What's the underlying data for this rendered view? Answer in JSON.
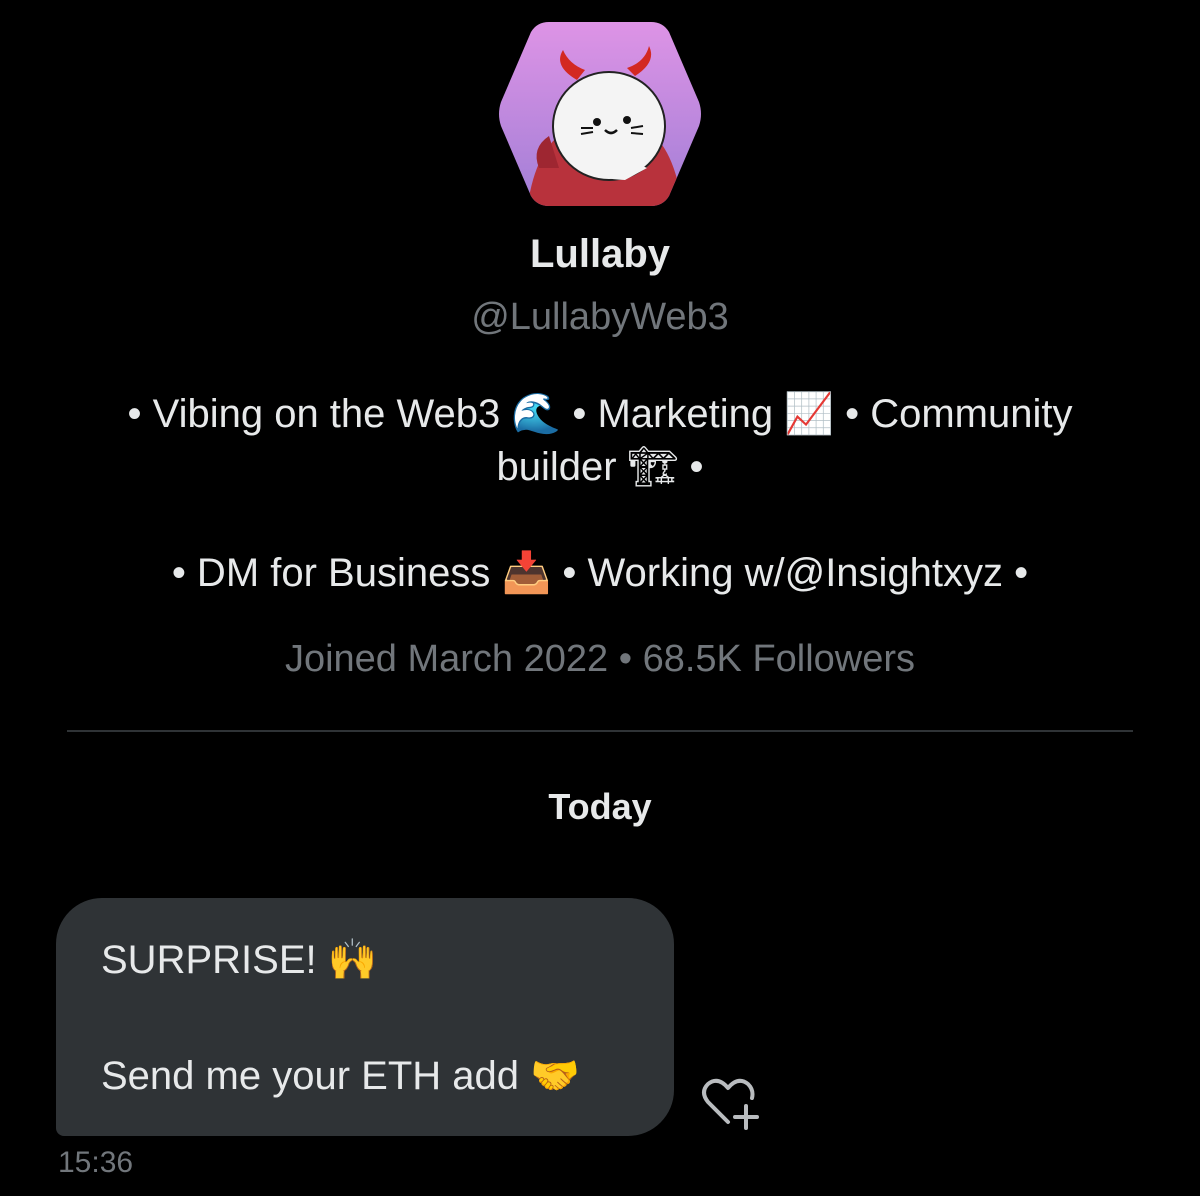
{
  "profile": {
    "name": "Lullaby",
    "handle": "@LullabyWeb3",
    "bio_line1": "• Vibing on the Web3 🌊 • Marketing 📈 • Community",
    "bio_line2": "builder 🏗 •",
    "bio_line3": "• DM for Business 📥 • Working w/@Insightxyz •",
    "meta": "Joined March 2022 • 68.5K Followers"
  },
  "conversation": {
    "date_separator": "Today",
    "messages": [
      {
        "line1": "SURPRISE! 🙌",
        "line2": "Send me your ETH add 🤝",
        "time": "15:36"
      }
    ]
  },
  "icons": {
    "avatar": "devil-horned-seal-avatar",
    "reaction": "heart-plus-icon"
  },
  "colors": {
    "background": "#000000",
    "primary_text": "#e7e9ea",
    "secondary_text": "#71767b",
    "bubble": "#2f3336",
    "avatar_bg": "#c88ee0"
  }
}
